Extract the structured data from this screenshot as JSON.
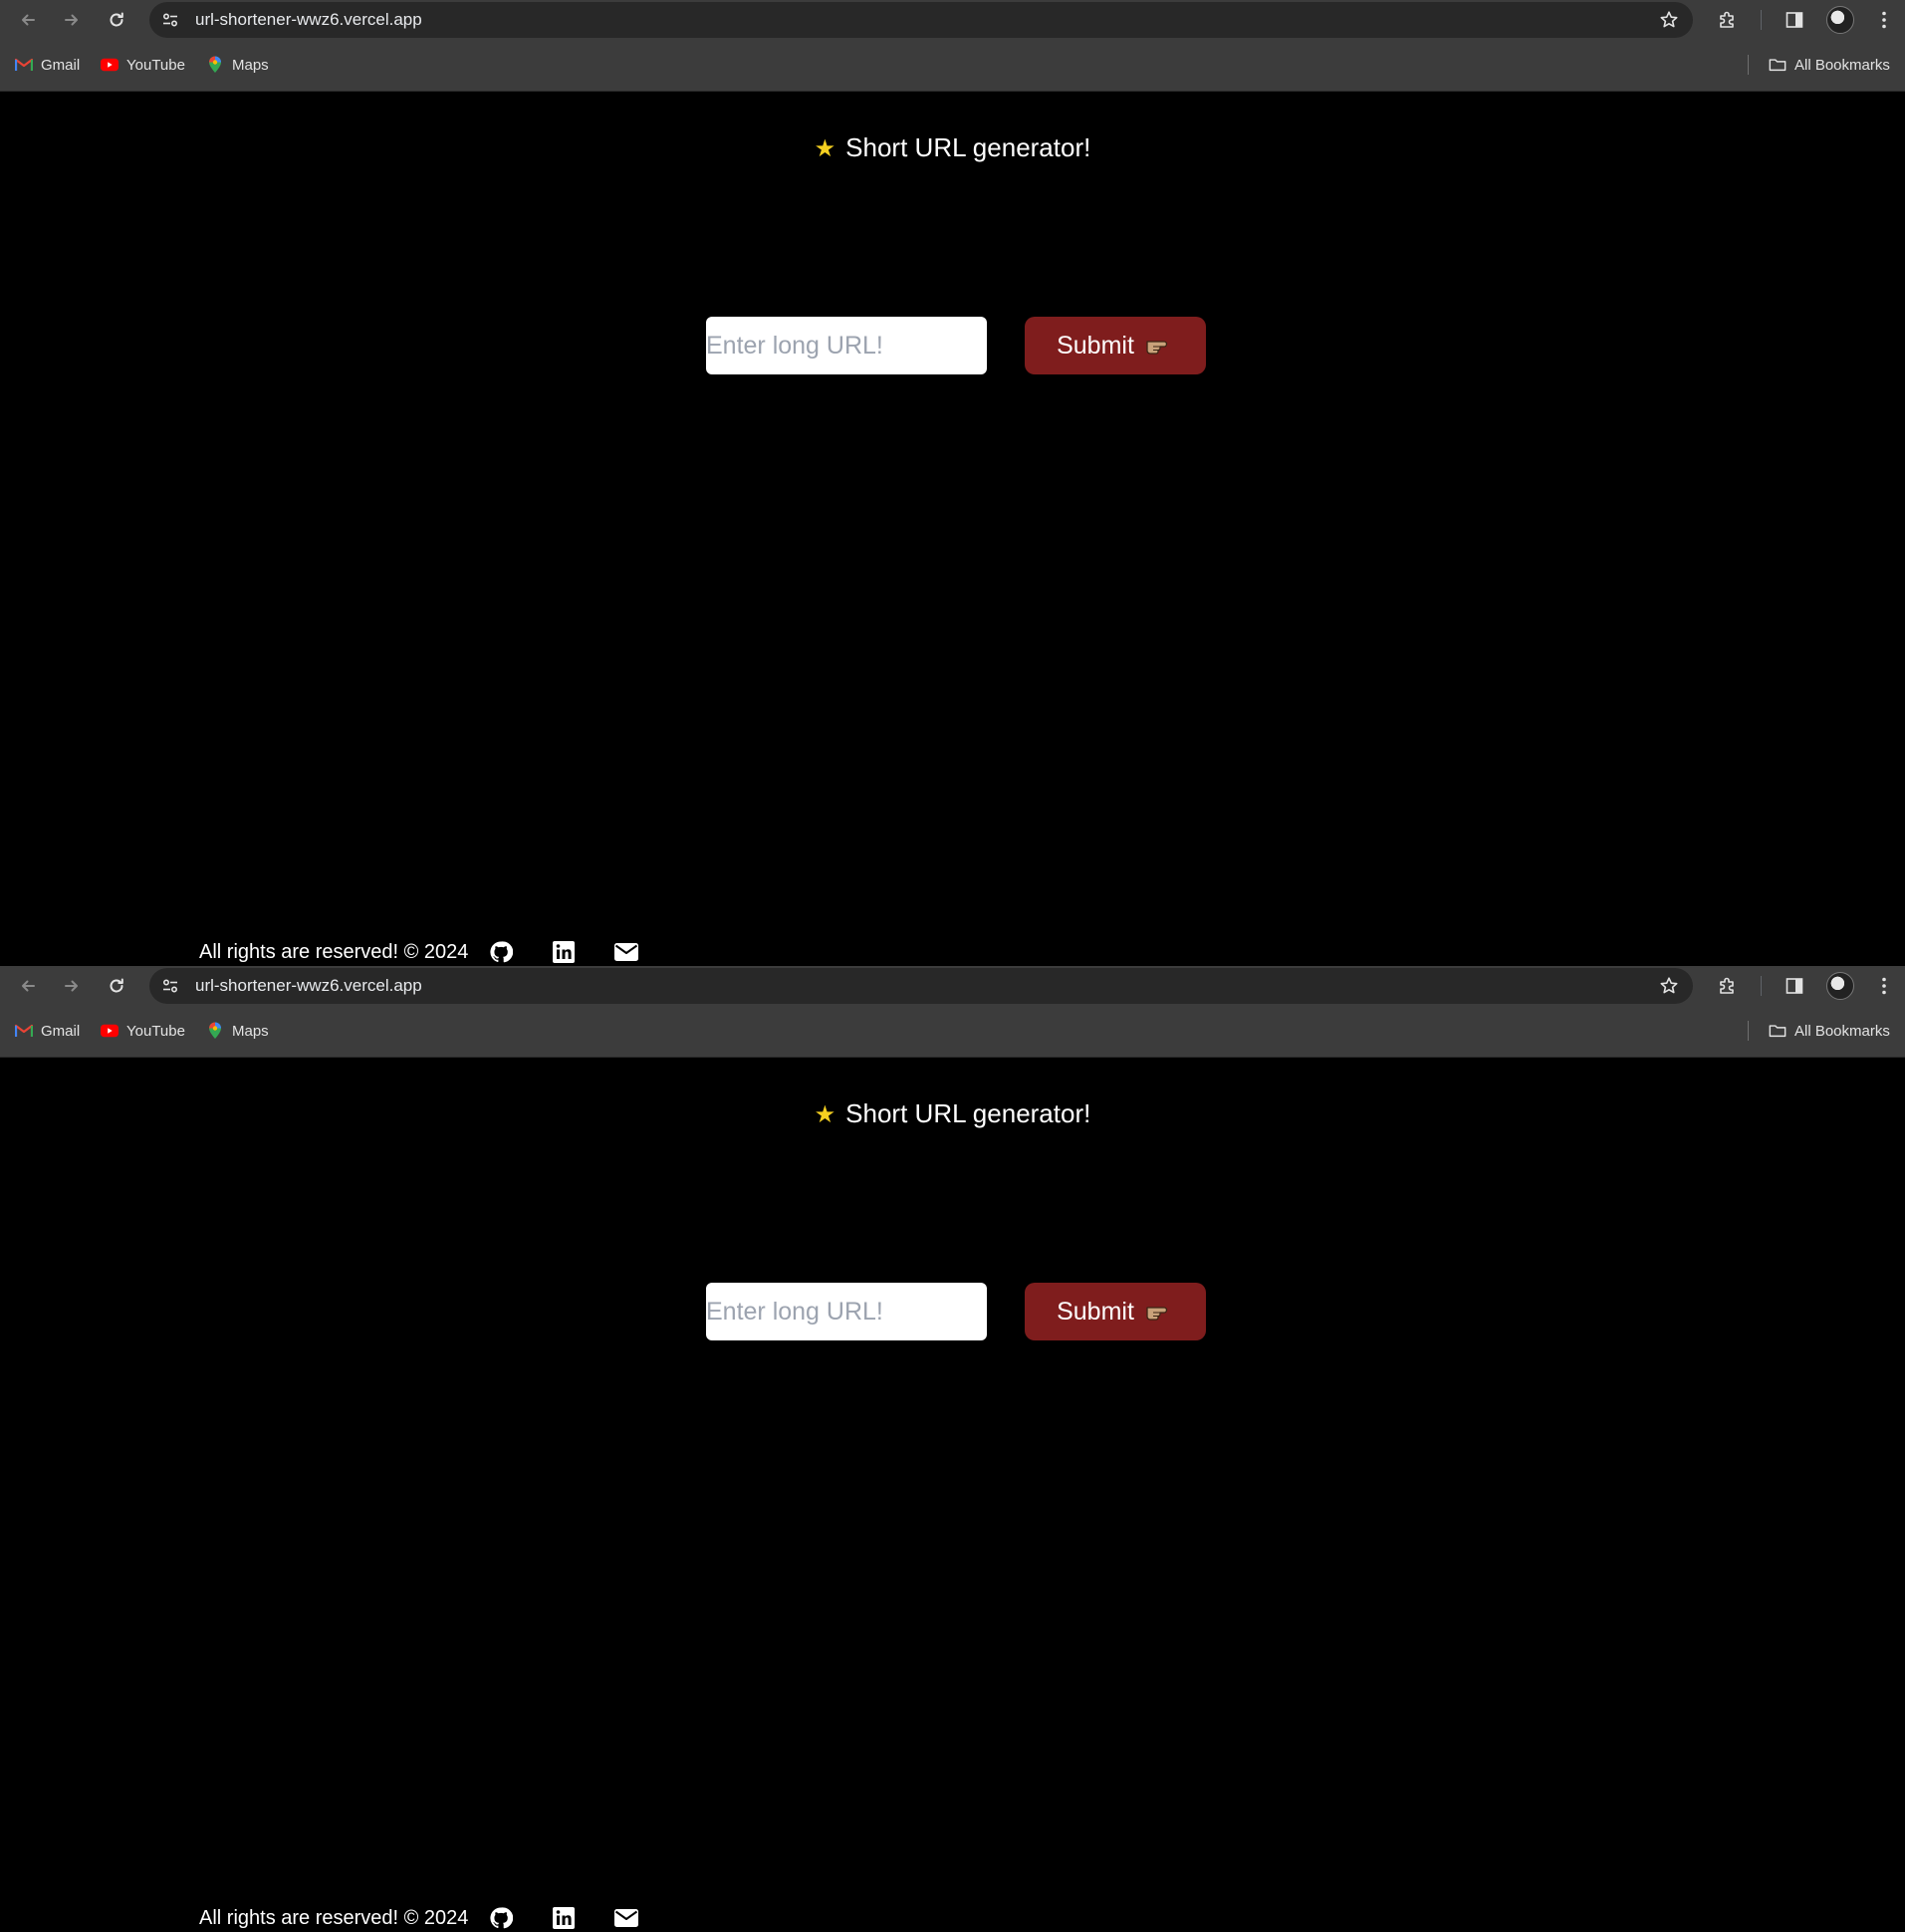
{
  "browser": {
    "url": "url-shortener-wwz6.vercel.app",
    "bookmarks": [
      {
        "label": "Gmail",
        "icon": "gmail-icon"
      },
      {
        "label": "YouTube",
        "icon": "youtube-icon"
      },
      {
        "label": "Maps",
        "icon": "maps-icon"
      }
    ],
    "all_bookmarks_label": "All Bookmarks"
  },
  "page": {
    "title_icon": "★",
    "title": "Short URL generator!",
    "input_placeholder": "Enter long URL!",
    "input_value": "",
    "submit_label": "Submit",
    "footer_text": "All rights are reserved! © 2024",
    "footer_links": [
      "github-icon",
      "linkedin-icon",
      "mail-icon"
    ]
  },
  "colors": {
    "page_background": "#000000",
    "submit_background": "#7f1d1d",
    "title_star": "#f5d020",
    "browser_toolbar": "#3c3c3c",
    "omnibox": "#282828"
  }
}
